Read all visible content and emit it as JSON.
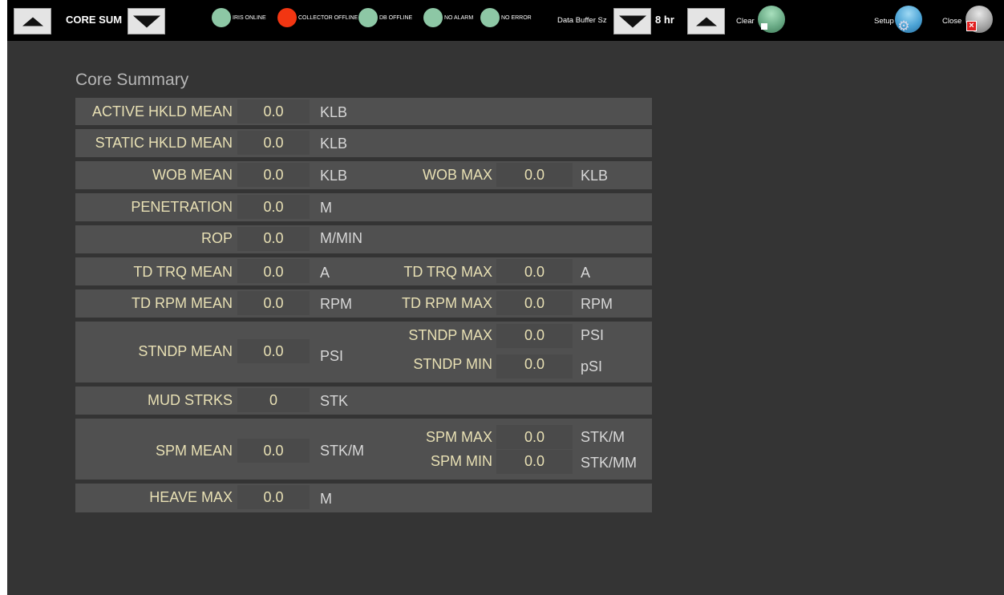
{
  "toolbar": {
    "view_name": "CORE SUM",
    "indicators": [
      {
        "label": "IRIS ONLINE",
        "color": "#8dc7a5"
      },
      {
        "label": "COLLECTOR OFFLINE",
        "color": "#f23612"
      },
      {
        "label": "DB OFFLINE",
        "color": "#8dc7a5"
      },
      {
        "label": "NO ALARM",
        "color": "#8dc7a5"
      },
      {
        "label": "NO ERROR",
        "color": "#8dc7a5"
      }
    ],
    "buffer_label": "Data Buffer Sz",
    "buffer_value": "8 hr",
    "clear_label": "Clear",
    "setup_label": "Setup",
    "close_label": "Close"
  },
  "panel": {
    "title": "Core Summary",
    "rows": [
      {
        "label": "ACTIVE HKLD MEAN",
        "value": "0.0",
        "unit": "KLB"
      },
      {
        "label": "STATIC HKLD MEAN",
        "value": "0.0",
        "unit": "KLB"
      },
      {
        "label": "WOB MEAN",
        "value": "0.0",
        "unit": "KLB",
        "label2": "WOB MAX",
        "value2": "0.0",
        "unit2": "KLB"
      },
      {
        "label": "PENETRATION",
        "value": "0.0",
        "unit": "M"
      },
      {
        "label": "ROP",
        "value": "0.0",
        "unit": "M/MIN"
      },
      {
        "label": "TD TRQ MEAN",
        "value": "0.0",
        "unit": "A",
        "label2": "TD TRQ MAX",
        "value2": "0.0",
        "unit2": "A"
      },
      {
        "label": "TD RPM MEAN",
        "value": "0.0",
        "unit": "RPM",
        "label2": "TD RPM MAX",
        "value2": "0.0",
        "unit2": "RPM"
      },
      {
        "label": "STNDP MEAN",
        "value": "0.0",
        "unit": "PSI",
        "label2": "STNDP MAX",
        "value2": "0.0",
        "unit2": "PSI",
        "label3": "STNDP MIN",
        "value3": "0.0",
        "unit3": "pSI"
      },
      {
        "label": "MUD STRKS",
        "value": "0",
        "unit": "STK"
      },
      {
        "label": "SPM MEAN",
        "value": "0.0",
        "unit": "STK/M",
        "label2": "SPM MAX",
        "value2": "0.0",
        "unit2": "STK/M",
        "label3": "SPM MIN",
        "value3": "0.0",
        "unit3": "STK/MM"
      },
      {
        "label": "HEAVE MAX",
        "value": "0.0",
        "unit": "M"
      }
    ]
  },
  "icons": {
    "scroll_up": "triangle-up-icon",
    "scroll_down": "triangle-down-icon",
    "setup": "gear-icon",
    "close": "red-x-icon",
    "clear": "white-square-icon"
  }
}
